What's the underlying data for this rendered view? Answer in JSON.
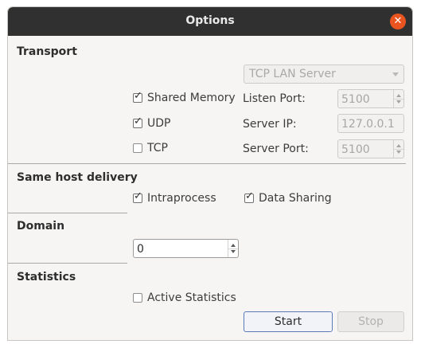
{
  "window": {
    "title": "Options"
  },
  "transport": {
    "heading": "Transport",
    "mode": {
      "selected": "TCP LAN Server"
    },
    "options": [
      {
        "label": "Shared Memory",
        "checked": true
      },
      {
        "label": "UDP",
        "checked": true
      },
      {
        "label": "TCP",
        "checked": false
      }
    ],
    "listen_port": {
      "label": "Listen Port:",
      "value": "5100"
    },
    "server_ip": {
      "label": "Server IP:",
      "value": "127.0.0.1"
    },
    "server_port": {
      "label": "Server Port:",
      "value": "5100"
    }
  },
  "same_host": {
    "heading": "Same host delivery",
    "options": [
      {
        "label": "Intraprocess",
        "checked": true
      },
      {
        "label": "Data Sharing",
        "checked": true
      }
    ]
  },
  "domain": {
    "heading": "Domain",
    "value": "0"
  },
  "statistics": {
    "heading": "Statistics",
    "active": {
      "label": "Active Statistics",
      "checked": false
    }
  },
  "buttons": {
    "start": "Start",
    "stop": "Stop"
  },
  "icons": {
    "close": "close-icon",
    "check": "checkmark-icon"
  },
  "colors": {
    "accent": "#e95420",
    "titlebar": "#303030",
    "focus": "#5b7bb8"
  }
}
